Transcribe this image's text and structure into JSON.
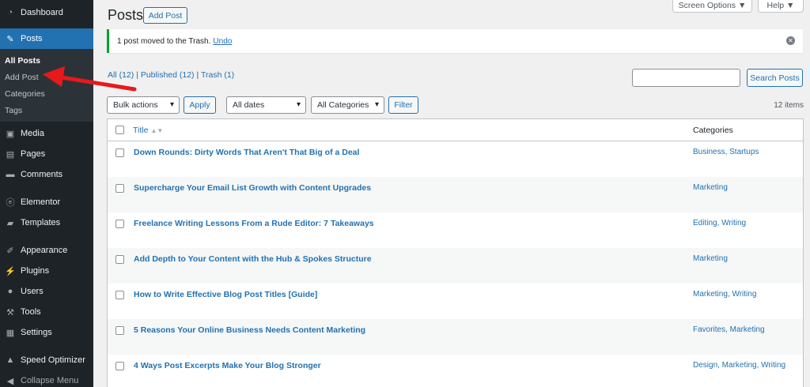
{
  "sidebar": {
    "dashboard": "Dashboard",
    "posts": "Posts",
    "submenu": [
      "All Posts",
      "Add Post",
      "Categories",
      "Tags"
    ],
    "media": "Media",
    "pages": "Pages",
    "comments": "Comments",
    "elementor": "Elementor",
    "templates": "Templates",
    "appearance": "Appearance",
    "plugins": "Plugins",
    "users": "Users",
    "tools": "Tools",
    "settings": "Settings",
    "speed_optimizer": "Speed Optimizer",
    "collapse": "Collapse Menu"
  },
  "header": {
    "title": "Posts",
    "add_post": "Add Post",
    "screen_options": "Screen Options ▼",
    "help": "Help ▼"
  },
  "notice": {
    "text": "1 post moved to the Trash.",
    "undo": "Undo"
  },
  "views": {
    "all": "All (12)",
    "published": "Published (12)",
    "trash": "Trash (1)"
  },
  "search": {
    "button": "Search Posts"
  },
  "filters": {
    "bulk_actions": "Bulk actions",
    "apply": "Apply",
    "dates": "All dates",
    "categories": "All Categories",
    "filter": "Filter",
    "items_count": "12 items"
  },
  "table": {
    "col_title": "Title",
    "col_categories": "Categories",
    "rows": [
      {
        "title": "Down Rounds: Dirty Words That Aren't That Big of a Deal",
        "categories": "Business, Startups"
      },
      {
        "title": "Supercharge Your Email List Growth with Content Upgrades",
        "categories": "Marketing"
      },
      {
        "title": "Freelance Writing Lessons From a Rude Editor: 7 Takeaways",
        "categories": "Editing, Writing"
      },
      {
        "title": "Add Depth to Your Content with the Hub & Spokes Structure",
        "categories": "Marketing"
      },
      {
        "title": "How to Write Effective Blog Post Titles [Guide]",
        "categories": "Marketing, Writing"
      },
      {
        "title": "5 Reasons Your Online Business Needs Content Marketing",
        "categories": "Favorites, Marketing"
      },
      {
        "title": "4 Ways Post Excerpts Make Your Blog Stronger",
        "categories": "Design, Marketing, Writing"
      }
    ]
  },
  "colors": {
    "sidebar_bg": "#1d2327",
    "active": "#2271b1",
    "link": "#2271b1",
    "notice_success": "#00a32a",
    "annotation_arrow": "#e8191b"
  }
}
